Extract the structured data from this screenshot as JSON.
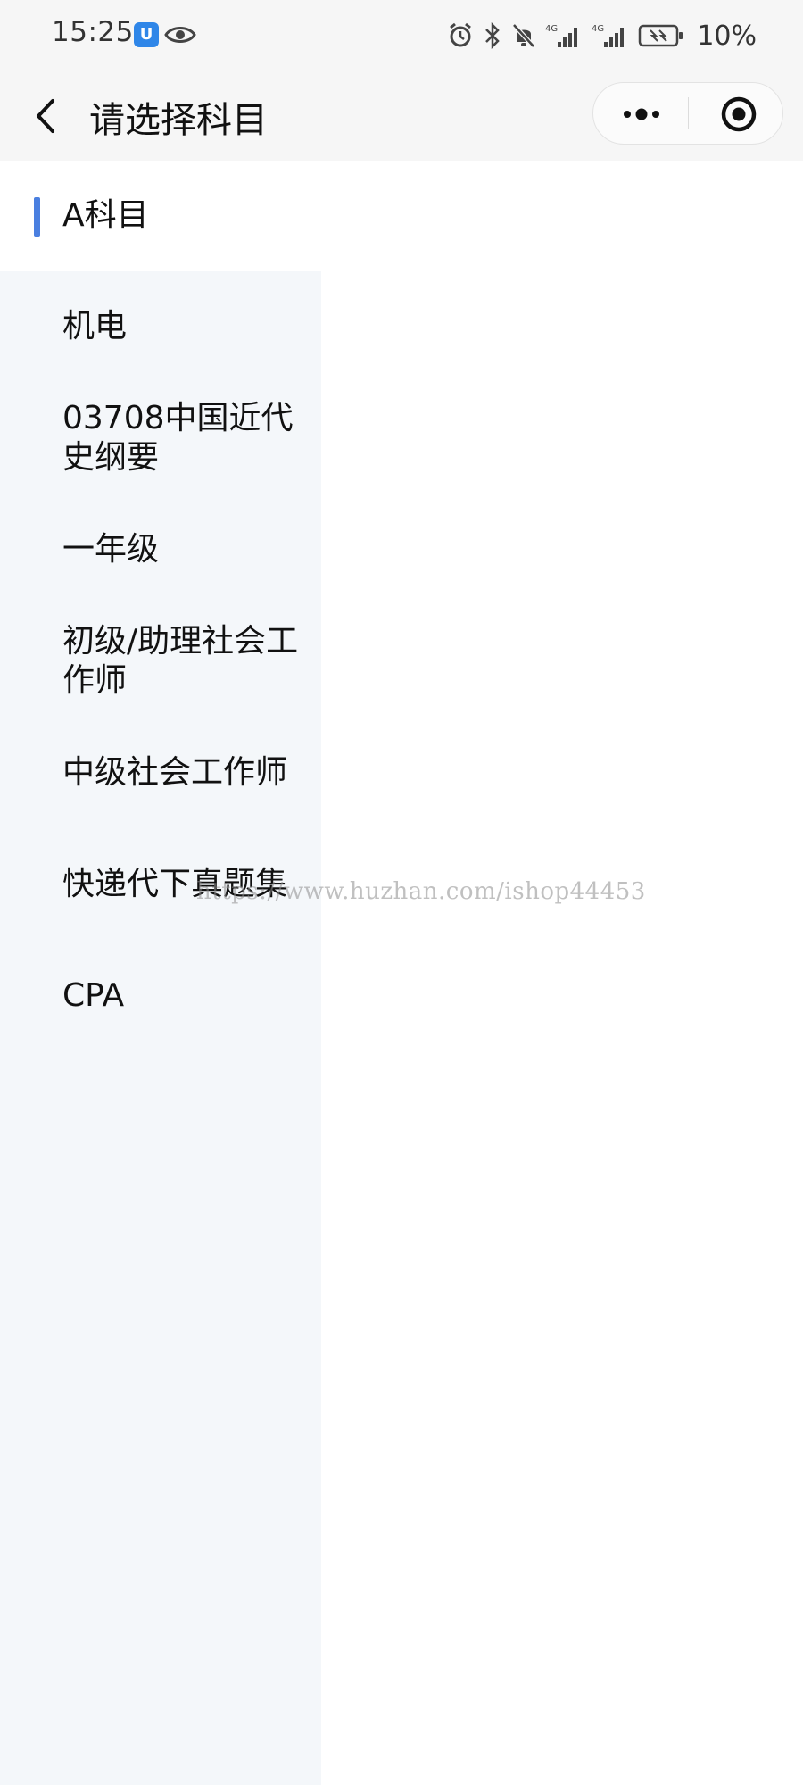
{
  "status_bar": {
    "time": "15:25",
    "battery_percent": "10%",
    "network_label_1": "4G",
    "network_label_2": "4G"
  },
  "nav": {
    "title": "请选择科目"
  },
  "sidebar": {
    "selected_index": 0,
    "items": [
      {
        "label": "A科目"
      },
      {
        "label": "机电"
      },
      {
        "label": "03708中国近代史纲要"
      },
      {
        "label": "一年级"
      },
      {
        "label": "初级/助理社会工作师"
      },
      {
        "label": "中级社会工作师"
      },
      {
        "label": "快递代下真题集"
      },
      {
        "label": "CPA"
      }
    ]
  },
  "watermark": {
    "text": "https://www.huzhan.com/ishop44453"
  },
  "colors": {
    "accent": "#4a7fe0",
    "sidebar_bg": "#f4f7fa",
    "header_bg": "#f6f6f6"
  }
}
